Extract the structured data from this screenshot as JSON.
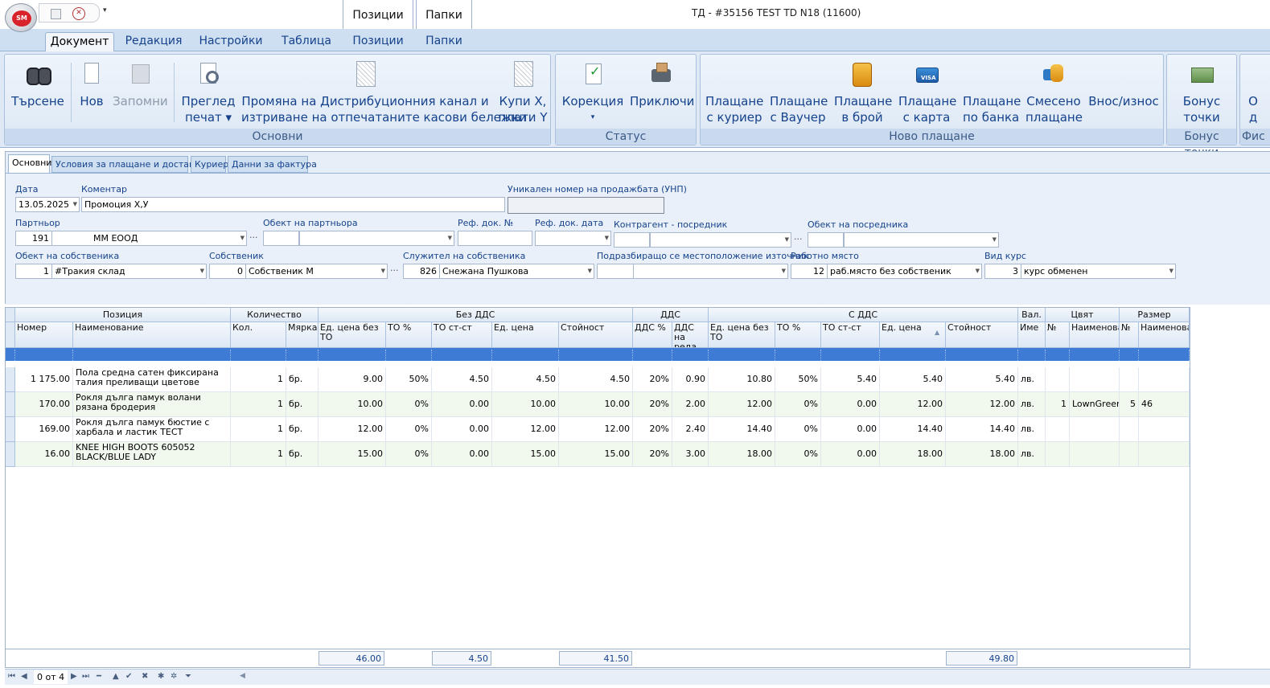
{
  "window": {
    "title": "ТД - #35156 TEST TD N18 (11600)",
    "qat_more": "▾"
  },
  "context_tab_groups": [
    {
      "label": "Позиции"
    },
    {
      "label": "Папки"
    }
  ],
  "ribbon_tabs": [
    {
      "label": "Документ",
      "active": true
    },
    {
      "label": "Редакция"
    },
    {
      "label": "Настройки"
    },
    {
      "label": "Таблица"
    },
    {
      "label": "Позиции"
    },
    {
      "label": "Папки"
    }
  ],
  "ribbon": {
    "groups": [
      {
        "label": "Основни"
      },
      {
        "label": "Статус"
      },
      {
        "label": "Ново плащане"
      },
      {
        "label": "Бонус точки"
      },
      {
        "label": "Фис"
      }
    ],
    "buttons": {
      "search": {
        "l1": "Търсене",
        "icon": "binoculars-icon"
      },
      "new": {
        "l1": "Нов",
        "icon": "new-document-icon"
      },
      "save": {
        "l1": "Запомни",
        "icon": "save-icon",
        "disabled": true
      },
      "preview": {
        "l1": "Преглед",
        "l2": "печат ▾",
        "icon": "print-preview-icon"
      },
      "change_channel": {
        "l1": "Промяна на Дистрибуционния канал и",
        "l2": "изтриване на отпечатаните касови бележки",
        "icon": "document-icon"
      },
      "buy_x": {
        "l1": "Купи X,",
        "l2": "плати Y",
        "icon": "document-icon"
      },
      "correction": {
        "l1": "Корекция",
        "l2": "▾",
        "icon": "correction-icon"
      },
      "finish": {
        "l1": "Приключи",
        "icon": "finish-stamp-icon"
      },
      "pay_courier": {
        "l1": "Плащане",
        "l2": "с куриер",
        "icon": "courier-icon"
      },
      "pay_voucher": {
        "l1": "Плащане",
        "l2": "с Ваучер",
        "icon": "voucher-icon"
      },
      "pay_cash": {
        "l1": "Плащане",
        "l2": "в брой",
        "icon": "cash-icon"
      },
      "pay_card": {
        "l1": "Плащане",
        "l2": "с карта",
        "icon": "credit-card-icon"
      },
      "pay_bank": {
        "l1": "Плащане",
        "l2": "по банка",
        "icon": "bank-icon"
      },
      "pay_mixed": {
        "l1": "Смесено",
        "l2": "плащане",
        "icon": "mixed-payment-icon"
      },
      "cash_inout": {
        "l1": "Внос/износ",
        "icon": "cash-in-out-icon"
      },
      "bonus": {
        "l1": "Бонус",
        "l2": "точки",
        "icon": "bonus-points-icon"
      },
      "fis": {
        "l1": "О",
        "l2": "д"
      }
    }
  },
  "form_tabs": [
    {
      "label": "Основни",
      "active": true
    },
    {
      "label": "Условия за плащане и доставка"
    },
    {
      "label": "Куриер"
    },
    {
      "label": "Данни за фактура"
    }
  ],
  "form": {
    "labels": {
      "date": "Дата",
      "comment": "Коментар",
      "unp": "Уникален номер на продажбата (УНП)",
      "partner": "Партньор",
      "partner_object": "Обект на партньора",
      "ref_no": "Реф. док. №",
      "ref_date": "Реф. док. дата",
      "counterparty": "Контрагент - посредник",
      "intermediary_object": "Обект на посредника",
      "owner_object": "Обект на собственика",
      "owner": "Собственик",
      "owner_employee": "Служител на собственика",
      "default_location": "Подразбиращо се местоположение източник",
      "workplace": "Работно място",
      "rate_type": "Вид курс"
    },
    "values": {
      "date": "13.05.2025",
      "comment": "Промоция X,У",
      "unp": "",
      "partner_id": "191",
      "partner_name": "ММ ЕООД",
      "owner_object_id": "1",
      "owner_object_name": "#Тракия склад",
      "owner_id": "0",
      "owner_name": "Собственик М",
      "employee_id": "826",
      "employee_name": "Снежана Пушкова",
      "workplace_id": "12",
      "workplace_name": "раб.място без собственик",
      "rate_id": "3",
      "rate_name": "курс обменен"
    },
    "ellipsis": "···"
  },
  "grid": {
    "bands": [
      {
        "label": "Позиция"
      },
      {
        "label": "Количество"
      },
      {
        "label": "Без ДДС"
      },
      {
        "label": "ДДС"
      },
      {
        "label": "С ДДС"
      },
      {
        "label": "Вал."
      },
      {
        "label": "Цвят"
      },
      {
        "label": "Размер"
      }
    ],
    "columns": [
      "Номер",
      "Наименование",
      "Кол.",
      "Мярка",
      "Ед. цена без ТО",
      "ТО %",
      "ТО ст-ст",
      "Ед. цена",
      "Стойност",
      "ДДС %",
      "ДДС на реда",
      "Ед. цена без ТО",
      "ТО %",
      "ТО ст-ст",
      "Ед. цена",
      "Стойност",
      "Име",
      "№",
      "Наименование",
      "№",
      "Наименование"
    ],
    "sort_indicator": "▲",
    "rows": [
      [
        "1 175.00",
        "Пола средна сатен фиксирана талия преливащи цветове",
        "1",
        "бр.",
        "9.00",
        "50%",
        "4.50",
        "4.50",
        "4.50",
        "20%",
        "0.90",
        "10.80",
        "50%",
        "5.40",
        "5.40",
        "5.40",
        "лв.",
        "",
        "",
        "",
        ""
      ],
      [
        "170.00",
        "Рокля дълга памук волани рязана бродерия",
        "1",
        "бр.",
        "10.00",
        "0%",
        "0.00",
        "10.00",
        "10.00",
        "20%",
        "2.00",
        "12.00",
        "0%",
        "0.00",
        "12.00",
        "12.00",
        "лв.",
        "1",
        "LownGreen",
        "5",
        "46"
      ],
      [
        "169.00",
        "Рокля дълга памук бюстие с харбала и ластик ТЕСТ",
        "1",
        "бр.",
        "12.00",
        "0%",
        "0.00",
        "12.00",
        "12.00",
        "20%",
        "2.40",
        "14.40",
        "0%",
        "0.00",
        "14.40",
        "14.40",
        "лв.",
        "",
        "",
        "",
        ""
      ],
      [
        "16.00",
        "KNEE HIGH BOOTS 605052 BLACK/BLUE LADY",
        "1",
        "бр.",
        "15.00",
        "0%",
        "0.00",
        "15.00",
        "15.00",
        "20%",
        "3.00",
        "18.00",
        "0%",
        "0.00",
        "18.00",
        "18.00",
        "лв.",
        "",
        "",
        "",
        ""
      ]
    ],
    "totals": {
      "unit_price_no_vat": "46.00",
      "discount_value": "4.50",
      "total_no_vat": "41.50",
      "total_with_vat": "49.80"
    }
  },
  "navigator": {
    "position": "0 от 4"
  },
  "colors": {
    "ribbon_bg": "#dfe9f5",
    "accent": "#15428b",
    "selected_row": "#3d7bd4",
    "alt_row": "#f1f8ee"
  }
}
